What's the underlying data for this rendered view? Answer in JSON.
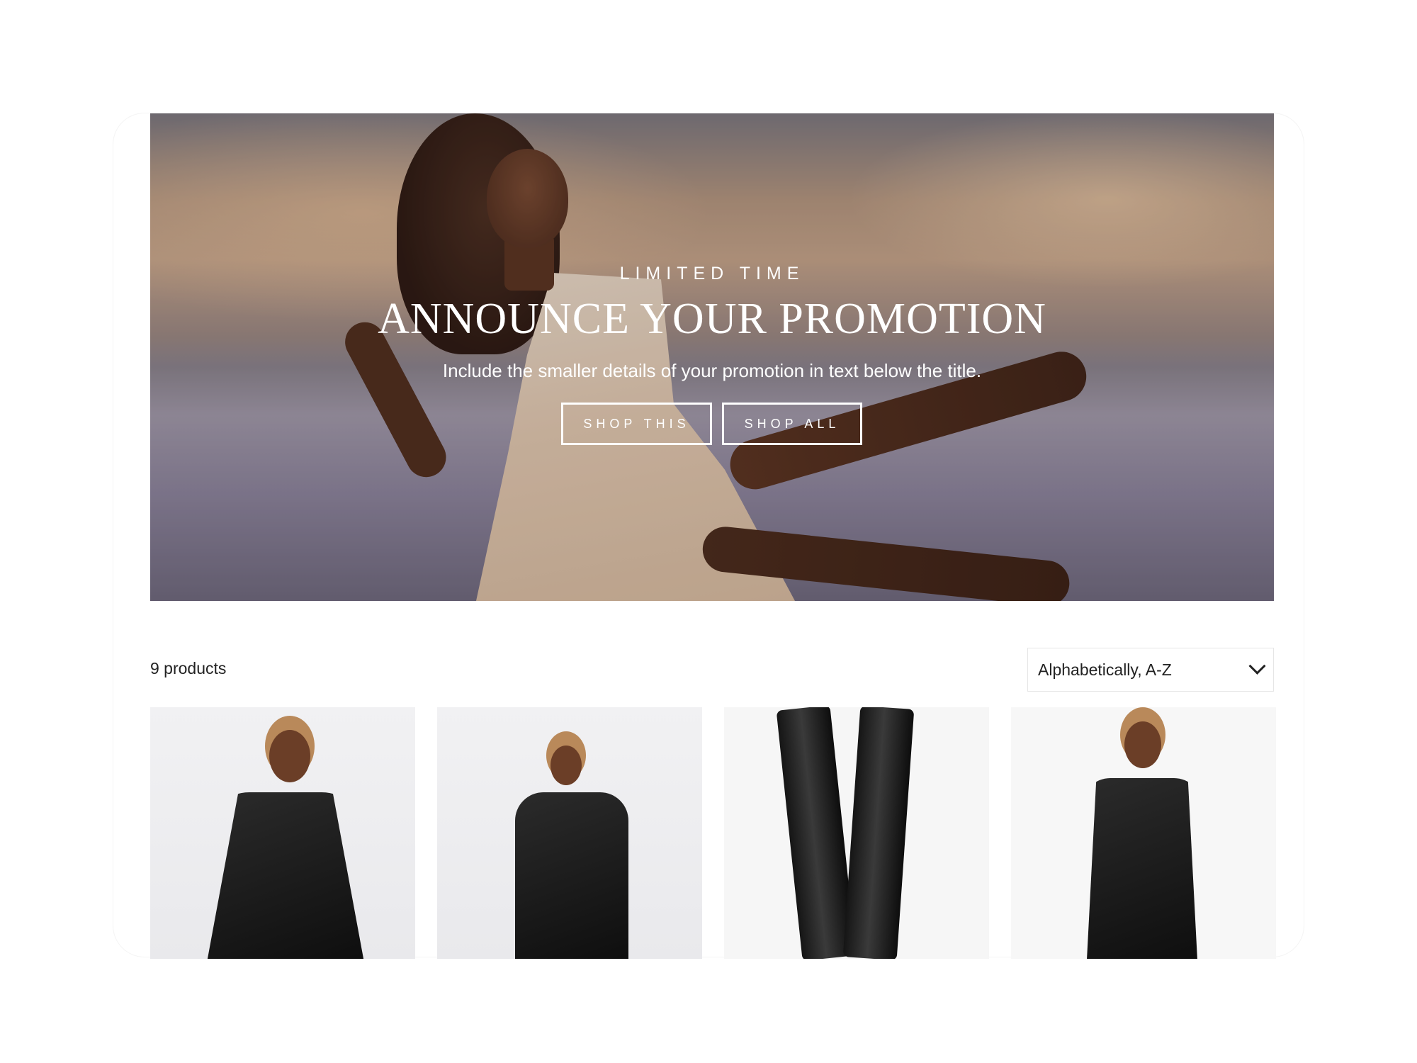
{
  "hero": {
    "eyebrow": "LIMITED TIME",
    "title": "ANNOUNCE YOUR PROMOTION",
    "subtitle": "Include the smaller details of your promotion in text below the title.",
    "buttons": [
      {
        "label": "SHOP THIS"
      },
      {
        "label": "SHOP ALL"
      }
    ]
  },
  "collection": {
    "product_count": "9 products",
    "sort": {
      "selected": "Alphabetically, A-Z",
      "icon": "chevron-down-icon"
    },
    "products": [
      {
        "image": "leather-blazer-photo"
      },
      {
        "image": "satin-top-and-leather-pants-photo"
      },
      {
        "image": "leather-pants-photo"
      },
      {
        "image": "leather-suit-photo"
      }
    ]
  }
}
